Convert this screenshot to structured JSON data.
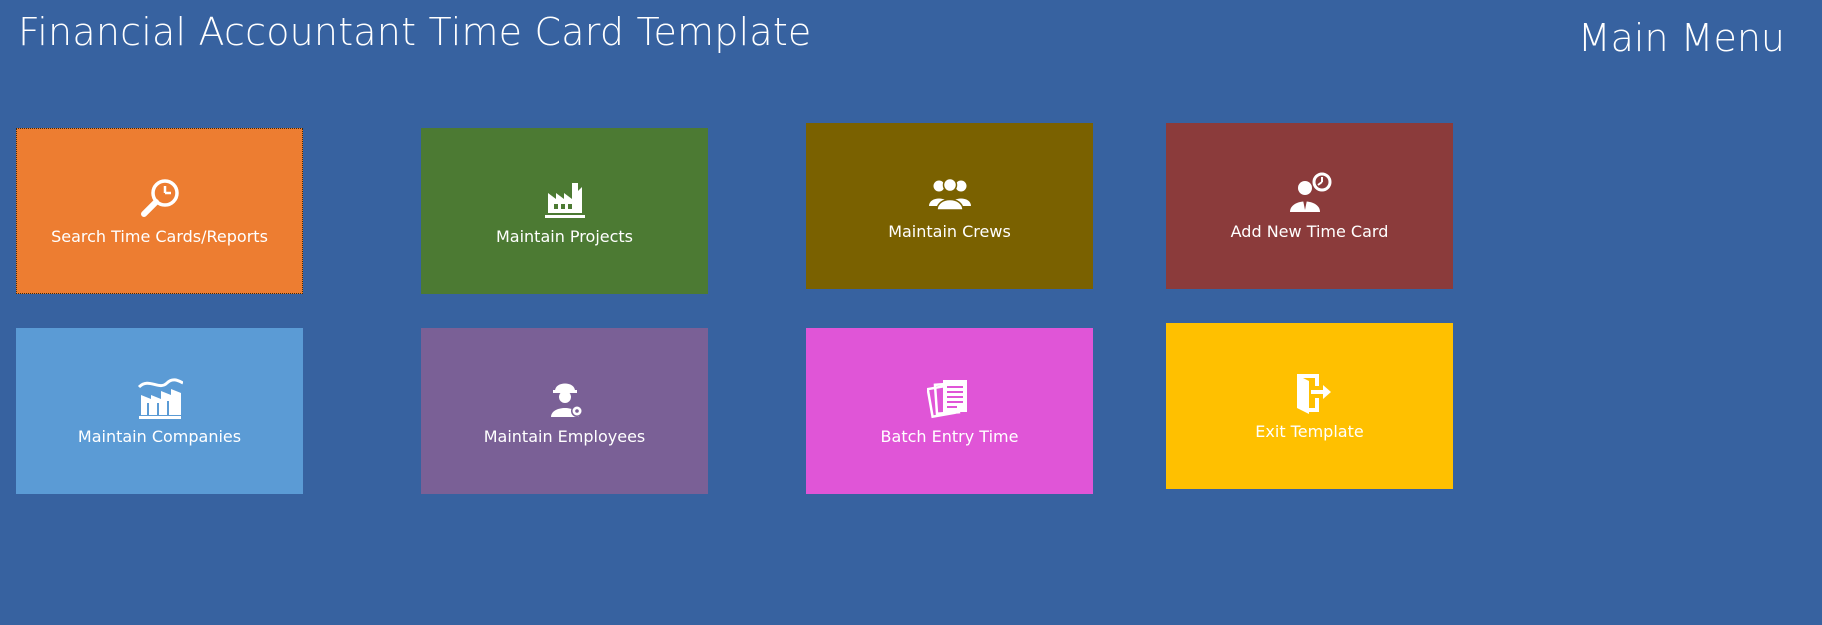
{
  "header": {
    "app_title": "Financial Accountant Time Card Template",
    "menu_title": "Main Menu"
  },
  "colors": {
    "background": "#3762a0",
    "search": "#ed7d31",
    "projects": "#4c7a33",
    "crews": "#7a6100",
    "add_time_card": "#8b3b3b",
    "companies": "#5b9bd5",
    "employees": "#7a6096",
    "batch_entry": "#e055d7",
    "exit": "#ffc000"
  },
  "tiles": {
    "search": {
      "label": "Search Time Cards/Reports",
      "icon": "magnifier-clock-icon"
    },
    "projects": {
      "label": "Maintain Projects",
      "icon": "factory-icon"
    },
    "crews": {
      "label": "Maintain Crews",
      "icon": "people-group-icon"
    },
    "add_time_card": {
      "label": "Add New Time Card",
      "icon": "person-clock-icon"
    },
    "companies": {
      "label": "Maintain Companies",
      "icon": "buildings-icon"
    },
    "employees": {
      "label": "Maintain Employees",
      "icon": "worker-gear-icon"
    },
    "batch_entry": {
      "label": "Batch Entry Time",
      "icon": "documents-icon"
    },
    "exit": {
      "label": "Exit Template",
      "icon": "exit-door-icon"
    }
  }
}
